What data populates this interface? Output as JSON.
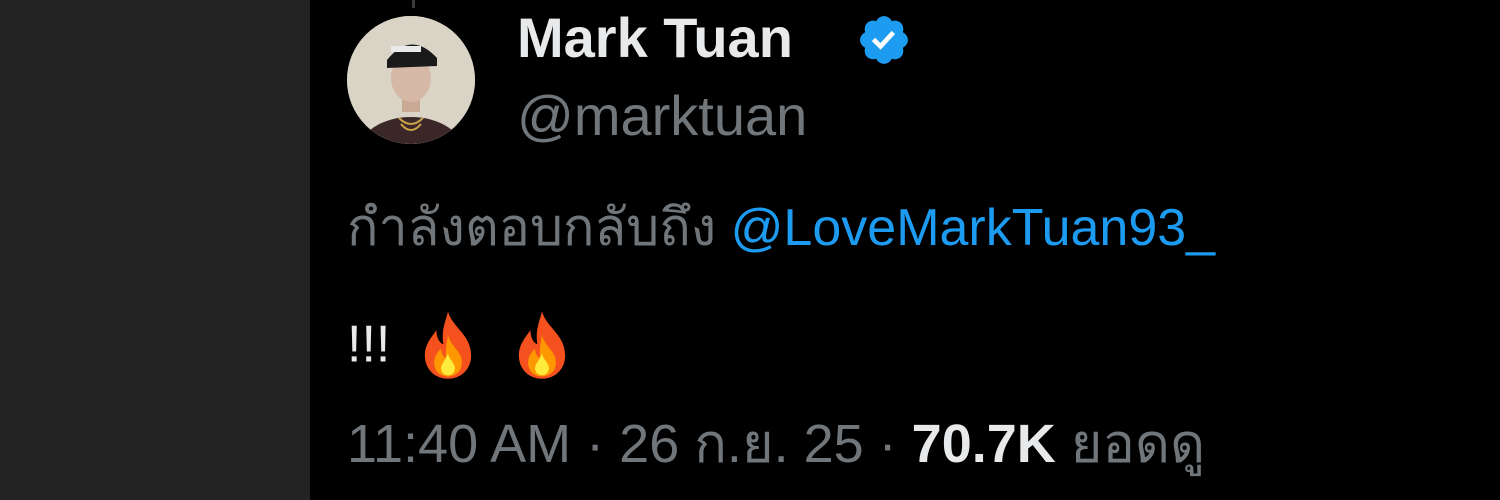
{
  "author": {
    "display_name": "Mark Tuan",
    "handle": "@marktuan",
    "verified": true,
    "avatar_alt": "profile-photo"
  },
  "reply": {
    "prefix": "กำลังตอบกลับถึง",
    "mention": "@LoveMarkTuan93_"
  },
  "tweet": {
    "text": "!!!",
    "emoji": [
      "fire",
      "fire"
    ]
  },
  "meta": {
    "time": "11:40 AM",
    "separator": "·",
    "date": "26 ก.ย. 25",
    "views_count": "70.7K",
    "views_label": "ยอดดู"
  },
  "colors": {
    "background": "#000000",
    "gutter": "#232323",
    "primary_text": "#e7e9ea",
    "secondary_text": "#71767b",
    "accent": "#1d9bf0"
  }
}
